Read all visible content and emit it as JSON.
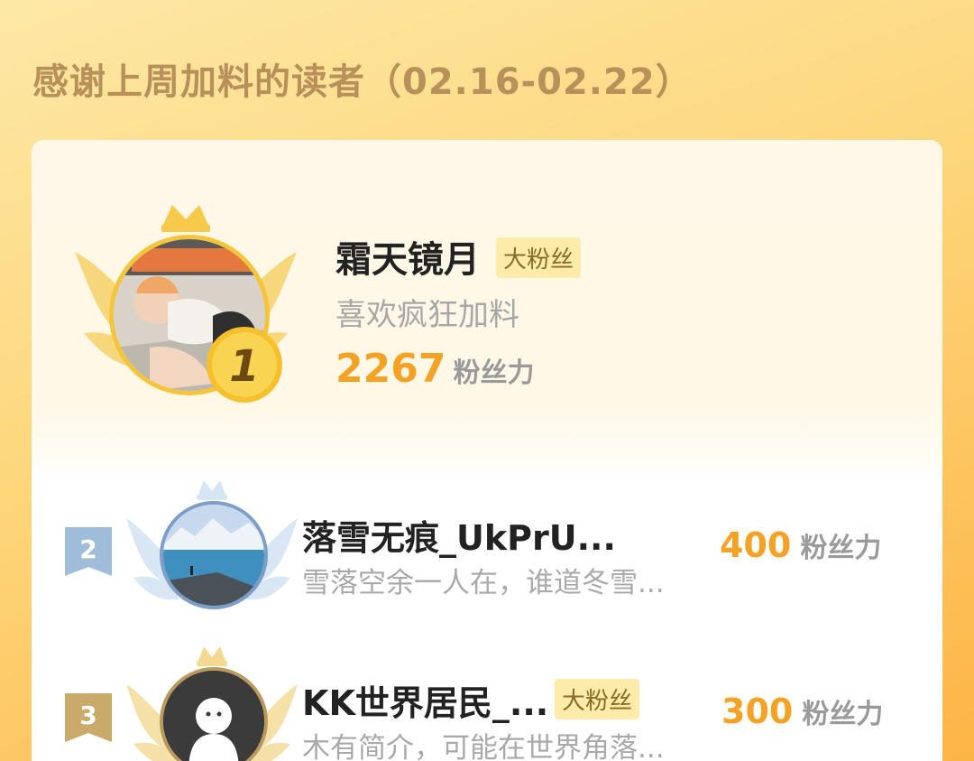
{
  "header": {
    "title": "感谢上周加料的读者（02.16-02.22）"
  },
  "top_reader": {
    "rank": "1",
    "name": "霜天镜月",
    "tag": "大粉丝",
    "bio": "喜欢疯狂加料",
    "score": "2267",
    "score_unit": "粉丝力"
  },
  "readers": [
    {
      "rank": "2",
      "name": "落雪无痕_UkPrU...",
      "bio": "雪落空余一人在，谁道冬雪...",
      "score": "400",
      "score_unit": "粉丝力"
    },
    {
      "rank": "3",
      "name": "KK世界居民_...",
      "tag": "大粉丝",
      "bio": "木有简介，可能在世界角落...",
      "score": "300",
      "score_unit": "粉丝力"
    }
  ],
  "colors": {
    "accent_score": "#f3a225",
    "gold": "#f4c53b",
    "title": "#b8905a",
    "tag_bg": "#fdeca9"
  }
}
